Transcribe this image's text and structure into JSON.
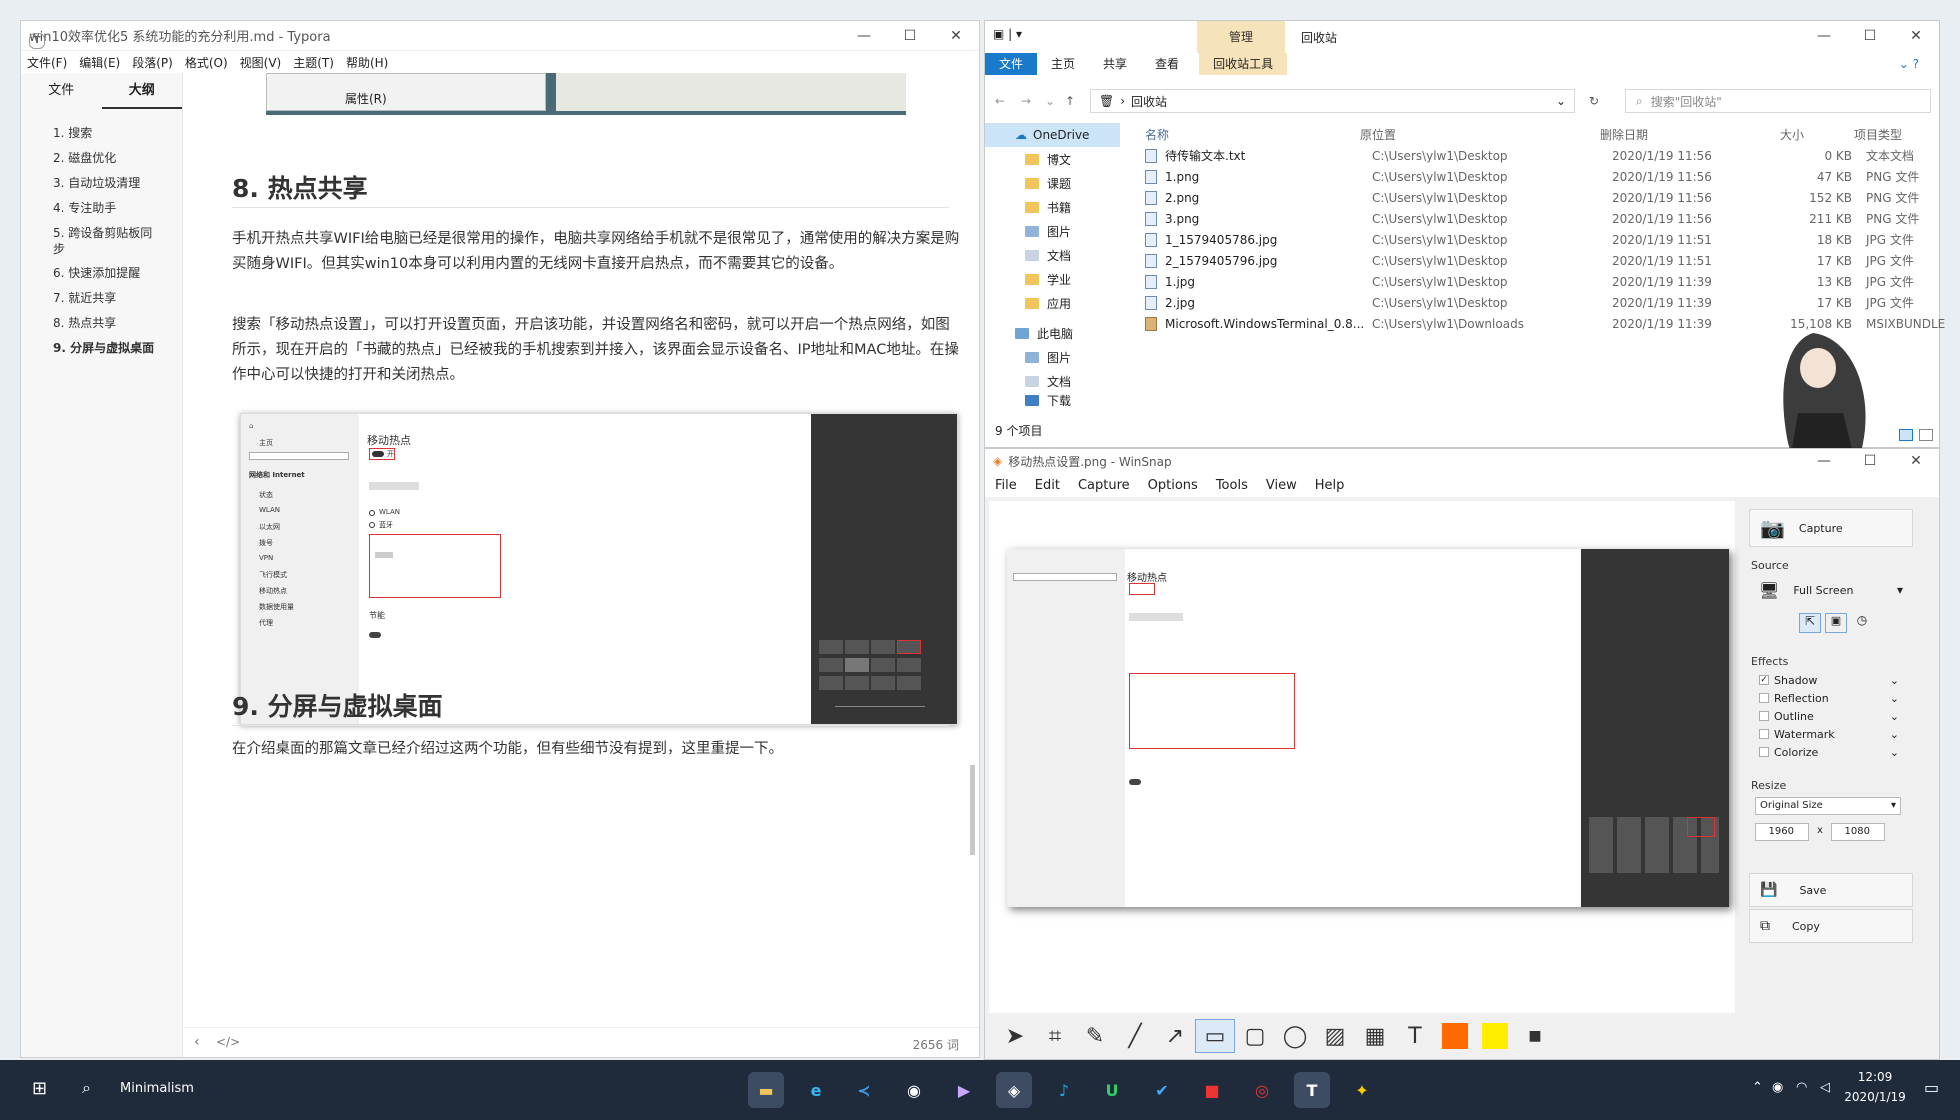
{
  "typora": {
    "title": "win10效率优化5 系统功能的充分利用.md - Typora",
    "menu": [
      "文件(F)",
      "编辑(E)",
      "段落(P)",
      "格式(O)",
      "视图(V)",
      "主题(T)",
      "帮助(H)"
    ],
    "tabs": [
      "文件",
      "大纲"
    ],
    "outline": [
      "1. 搜索",
      "2. 磁盘优化",
      "3. 自动垃圾清理",
      "4. 专注助手",
      "5. 跨设备剪贴板同步",
      "6. 快速添加提醒",
      "7. 就近共享",
      "8. 热点共享",
      "9. 分屏与虚拟桌面"
    ],
    "context_menu_item": "属性(R)",
    "h8": "8. 热点共享",
    "p1": "手机开热点共享WIFI给电脑已经是很常用的操作，电脑共享网络给手机就不是很常见了，通常使用的解决方案是购买随身WIFI。但其实win10本身可以利用内置的无线网卡直接开启热点，而不需要其它的设备。",
    "p2": "搜索「移动热点设置」，可以打开设置页面，开启该功能，并设置网络名和密码，就可以开启一个热点网络，如图所示，现在开启的「书藏的热点」已经被我的手机搜索到并接入，该界面会显示设备名、IP地址和MAC地址。在操作中心可以快捷的打开和关闭热点。",
    "h9": "9. 分屏与虚拟桌面",
    "p3": "在介绍桌面的那篇文章已经介绍过这两个功能，但有些细节没有提到，这里重提一下。",
    "word_count": "2656 词",
    "screenshot": {
      "heading": "移动热点",
      "sidebar": [
        "主页",
        "网络和 Internet",
        "状态",
        "WLAN",
        "以太网",
        "拨号",
        "VPN",
        "飞行模式",
        "移动热点",
        "数据使用量",
        "代理"
      ],
      "wlan": "WLAN",
      "bluetooth": "蓝牙",
      "section": "节能",
      "on": "开"
    }
  },
  "explorer": {
    "ribbon_tabs": [
      "文件",
      "主页",
      "共享",
      "查看"
    ],
    "manage_tab": "管理",
    "recycle_tools": "回收站工具",
    "title": "回收站",
    "address": "回收站",
    "search_placeholder": "搜索\"回收站\"",
    "nav": [
      "OneDrive",
      "博文",
      "课题",
      "书籍",
      "图片",
      "文档",
      "学业",
      "应用",
      "此电脑",
      "图片",
      "文档",
      "下载"
    ],
    "columns": [
      "名称",
      "原位置",
      "删除日期",
      "大小",
      "项目类型"
    ],
    "files": [
      {
        "name": "待传输文本.txt",
        "loc": "C:\\Users\\ylw1\\Desktop",
        "date": "2020/1/19 11:56",
        "size": "0 KB",
        "type": "文本文档"
      },
      {
        "name": "1.png",
        "loc": "C:\\Users\\ylw1\\Desktop",
        "date": "2020/1/19 11:56",
        "size": "47 KB",
        "type": "PNG 文件"
      },
      {
        "name": "2.png",
        "loc": "C:\\Users\\ylw1\\Desktop",
        "date": "2020/1/19 11:56",
        "size": "152 KB",
        "type": "PNG 文件"
      },
      {
        "name": "3.png",
        "loc": "C:\\Users\\ylw1\\Desktop",
        "date": "2020/1/19 11:56",
        "size": "211 KB",
        "type": "PNG 文件"
      },
      {
        "name": "1_1579405786.jpg",
        "loc": "C:\\Users\\ylw1\\Desktop",
        "date": "2020/1/19 11:51",
        "size": "18 KB",
        "type": "JPG 文件"
      },
      {
        "name": "2_1579405796.jpg",
        "loc": "C:\\Users\\ylw1\\Desktop",
        "date": "2020/1/19 11:51",
        "size": "17 KB",
        "type": "JPG 文件"
      },
      {
        "name": "1.jpg",
        "loc": "C:\\Users\\ylw1\\Desktop",
        "date": "2020/1/19 11:39",
        "size": "13 KB",
        "type": "JPG 文件"
      },
      {
        "name": "2.jpg",
        "loc": "C:\\Users\\ylw1\\Desktop",
        "date": "2020/1/19 11:39",
        "size": "17 KB",
        "type": "JPG 文件"
      },
      {
        "name": "Microsoft.WindowsTerminal_0.8...",
        "loc": "C:\\Users\\ylw1\\Downloads",
        "date": "2020/1/19 11:39",
        "size": "15,108 KB",
        "type": "MSIXBUNDLE"
      }
    ],
    "status": "9 个项目"
  },
  "winsnap": {
    "title": "移动热点设置.png - WinSnap",
    "menu": [
      "File",
      "Edit",
      "Capture",
      "Options",
      "Tools",
      "View",
      "Help"
    ],
    "capture": "Capture",
    "source_label": "Source",
    "source_value": "Full Screen",
    "effects_label": "Effects",
    "effects": [
      {
        "label": "Shadow",
        "checked": true
      },
      {
        "label": "Reflection",
        "checked": false
      },
      {
        "label": "Outline",
        "checked": false
      },
      {
        "label": "Watermark",
        "checked": false
      },
      {
        "label": "Colorize",
        "checked": false
      }
    ],
    "resize_label": "Resize",
    "resize_mode": "Original Size",
    "width": "1960",
    "height": "1080",
    "times": "x",
    "save": "Save",
    "copy": "Copy",
    "colors": {
      "primary": "#ff6a00",
      "secondary": "#ffee00"
    }
  },
  "taskbar": {
    "search_text": "Minimalism",
    "time": "12:09",
    "date": "2020/1/19"
  }
}
